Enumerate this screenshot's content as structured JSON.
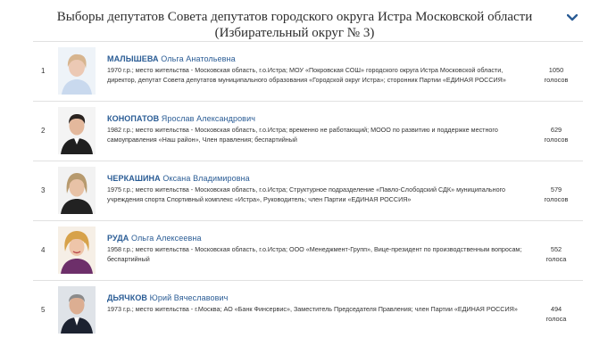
{
  "header": {
    "title": "Выборы депутатов Совета депутатов городского округа Истра Московской области (Избирательный округ № 3)",
    "toggle_icon": "chevron-down-icon"
  },
  "colors": {
    "accent": "#2a5c95",
    "divider": "#e1e1e1"
  },
  "candidates": [
    {
      "number": "1",
      "surname": "МАЛЫШЕВА",
      "given": "Ольга Анатольевна",
      "bio": "1970 г.р.; место жительства - Московская область, г.о.Истра; МОУ «Покровская СОШ» городского округа Истра Московской области, директор, депутат Совета депутатов муниципального образования «Городской округ Истра»; сторонник Партии «ЕДИНАЯ РОССИЯ»",
      "votes": "1050",
      "votes_unit": "голосов"
    },
    {
      "number": "2",
      "surname": "КОНОПАТОВ",
      "given": "Ярослав Александрович",
      "bio": "1982 г.р.; место жительства - Московская область, г.о.Истра; временно не работающий; МООО по развитию и поддержке местного самоуправления «Наш район», Член правления; беспартийный",
      "votes": "629",
      "votes_unit": "голосов"
    },
    {
      "number": "3",
      "surname": "ЧЕРКАШИНА",
      "given": "Оксана Владимировна",
      "bio": "1975 г.р.; место жительства - Московская область, г.о.Истра; Структурное подразделение «Павло-Слободский СДК» муниципального учреждения спорта Спортивный комплекс «Истра», Руководитель; член Партии «ЕДИНАЯ РОССИЯ»",
      "votes": "579",
      "votes_unit": "голосов"
    },
    {
      "number": "4",
      "surname": "РУДА",
      "given": "Ольга Алексеевна",
      "bio": "1958 г.р.; место жительства - Московская область, г.о.Истра; ООО «Менеджмент-Групп», Вице-президент по производственным вопросам; беспартийный",
      "votes": "552",
      "votes_unit": "голоса"
    },
    {
      "number": "5",
      "surname": "ДЬЯЧКОВ",
      "given": "Юрий Вячеславович",
      "bio": "1973 г.р.; место жительства - г.Москва; АО «Банк Финсервис», Заместитель Председателя Правления; член Партии «ЕДИНАЯ РОССИЯ»",
      "votes": "494",
      "votes_unit": "голоса"
    }
  ]
}
